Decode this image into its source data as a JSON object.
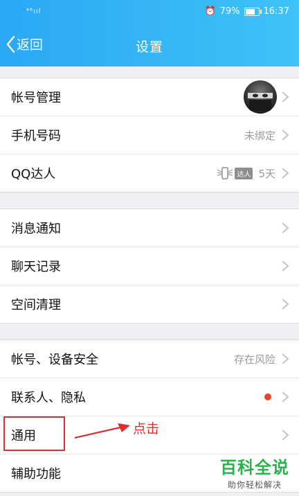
{
  "status_bar": {
    "signal_text": "⁴⁶ııl",
    "battery": "79%",
    "time": "16:37",
    "battery_level": 0.79
  },
  "header": {
    "back_label": "返回",
    "title": "设置"
  },
  "groups": [
    {
      "items": [
        {
          "label": "帐号管理",
          "value": ""
        },
        {
          "label": "手机号码",
          "value": "未绑定"
        },
        {
          "label": "QQ达人",
          "value": "5天",
          "badge": "达人"
        }
      ]
    },
    {
      "items": [
        {
          "label": "消息通知"
        },
        {
          "label": "聊天记录"
        },
        {
          "label": "空间清理"
        }
      ]
    },
    {
      "items": [
        {
          "label": "帐号、设备安全",
          "value": "存在风险"
        },
        {
          "label": "联系人、隐私"
        },
        {
          "label": "通用"
        },
        {
          "label": "辅助功能"
        }
      ]
    }
  ],
  "annotation": {
    "text": "点击",
    "color": "#d9302e"
  },
  "watermark": {
    "main": "百科全说",
    "sub": "助你轻松解决"
  },
  "colors": {
    "header_start": "#2aa8f5",
    "header_end": "#3ec3f7",
    "dot": "#e8442f",
    "watermark": "#2bb24c"
  }
}
